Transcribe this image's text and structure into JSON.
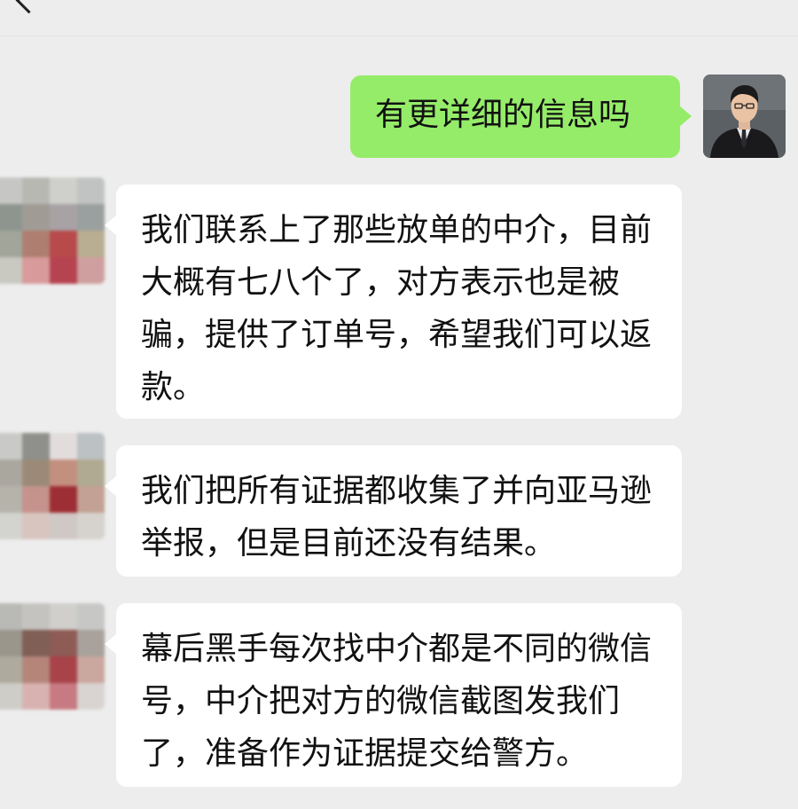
{
  "chat": {
    "outgoing": {
      "text": "有更详细的信息吗"
    },
    "incoming": [
      {
        "text": "我们联系上了那些放单的中介，目前大概有七八个了，对方表示也是被骗，提供了订单号，希望我们可以返款。"
      },
      {
        "text": "我们把所有证据都收集了并向亚马逊举报，但是目前还没有结果。"
      },
      {
        "text": "幕后黑手每次找中介都是不同的微信号，中介把对方的微信截图发我们了，准备作为证据提交给警方。"
      }
    ]
  },
  "colors": {
    "background": "#ededed",
    "outgoing_bubble": "#95ec69",
    "incoming_bubble": "#ffffff",
    "text": "#111111"
  }
}
